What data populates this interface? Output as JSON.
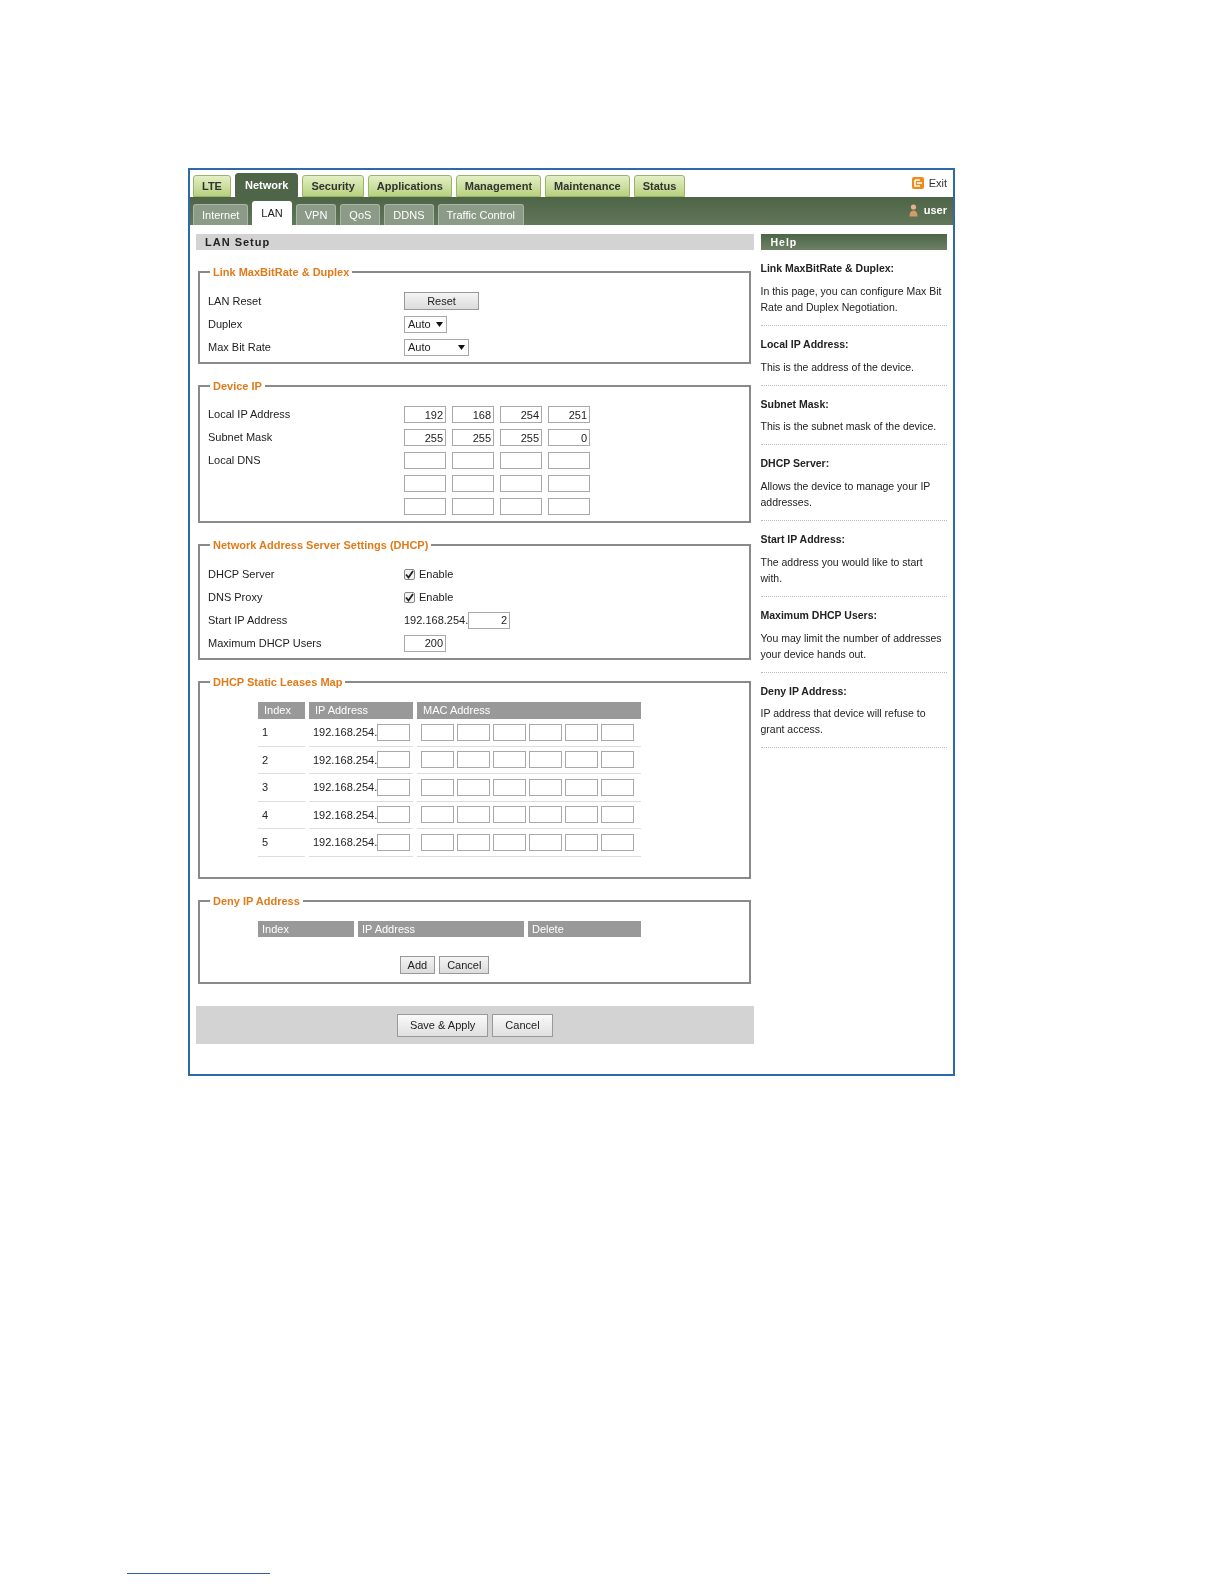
{
  "main_tabs": [
    {
      "label": "LTE",
      "selected": false
    },
    {
      "label": "Network",
      "selected": true
    },
    {
      "label": "Security",
      "selected": false
    },
    {
      "label": "Applications",
      "selected": false
    },
    {
      "label": "Management",
      "selected": false
    },
    {
      "label": "Maintenance",
      "selected": false
    },
    {
      "label": "Status",
      "selected": false
    }
  ],
  "exit_link": "Exit",
  "sub_tabs": [
    {
      "label": "Internet",
      "selected": false
    },
    {
      "label": "LAN",
      "selected": true
    },
    {
      "label": "VPN",
      "selected": false
    },
    {
      "label": "QoS",
      "selected": false
    },
    {
      "label": "DDNS",
      "selected": false
    },
    {
      "label": "Traffic Control",
      "selected": false
    }
  ],
  "user": "user",
  "section_title": "LAN Setup",
  "groups": [
    {
      "legend": "Link MaxBitRate & Duplex",
      "rows": [
        {
          "kind": "button",
          "label": "LAN Reset",
          "value": "Reset"
        },
        {
          "kind": "select",
          "label": "Duplex",
          "value": "Auto"
        },
        {
          "kind": "select",
          "label": "Max Bit Rate",
          "value": "Auto"
        }
      ]
    },
    {
      "legend": "Device IP",
      "rows": [
        {
          "kind": "ip",
          "label": "Local IP Address",
          "octets": [
            "192",
            "168",
            "254",
            "251"
          ]
        },
        {
          "kind": "ip",
          "label": "Subnet Mask",
          "octets": [
            "255",
            "255",
            "255",
            "0"
          ]
        },
        {
          "kind": "ip_empty",
          "label": "Local DNS"
        },
        {
          "kind": "ip_empty"
        },
        {
          "kind": "ip_empty"
        }
      ]
    },
    {
      "legend": "Network Address Server Settings (DHCP)",
      "rows": [
        {
          "kind": "checkbox",
          "label": "DHCP Server",
          "checked": true,
          "text": "Enable"
        },
        {
          "kind": "checkbox",
          "label": "DNS Proxy",
          "checked": true,
          "text": "Enable"
        },
        {
          "kind": "prefix_input",
          "label": "Start IP Address",
          "prefix": "192.168.254.",
          "value": "2"
        },
        {
          "kind": "input",
          "label": "Maximum DHCP Users",
          "value": "200"
        }
      ]
    }
  ],
  "leases": {
    "legend": "DHCP Static Leases Map",
    "columns": [
      "Index",
      "IP Address",
      "MAC Address"
    ],
    "rows": [
      {
        "index": "1",
        "ip_prefix": "192.168.254."
      },
      {
        "index": "2",
        "ip_prefix": "192.168.254."
      },
      {
        "index": "3",
        "ip_prefix": "192.168.254."
      },
      {
        "index": "4",
        "ip_prefix": "192.168.254."
      },
      {
        "index": "5",
        "ip_prefix": "192.168.254."
      }
    ]
  },
  "deny": {
    "legend": "Deny IP Address",
    "columns": [
      "Index",
      "IP Address",
      "Delete"
    ],
    "buttons": [
      "Add",
      "Cancel"
    ]
  },
  "footer_buttons": [
    "Save & Apply",
    "Cancel"
  ],
  "help_title": "Help",
  "help": [
    {
      "title": "Link MaxBitRate & Duplex:",
      "text": "In this page, you can configure Max Bit Rate and Duplex Negotiation."
    },
    {
      "title": "Local IP Address:",
      "text": "This is the address of the device."
    },
    {
      "title": "Subnet Mask:",
      "text": "This is the subnet mask of the device."
    },
    {
      "title": "DHCP Server:",
      "text": "Allows the device to manage your IP addresses."
    },
    {
      "title": "Start IP Address:",
      "text": "The address you would like to start with."
    },
    {
      "title": "Maximum DHCP Users:",
      "text": "You may limit the number of addresses your device hands out."
    },
    {
      "title": "Deny IP Address:",
      "text": "IP address that device will refuse to grant access."
    }
  ]
}
